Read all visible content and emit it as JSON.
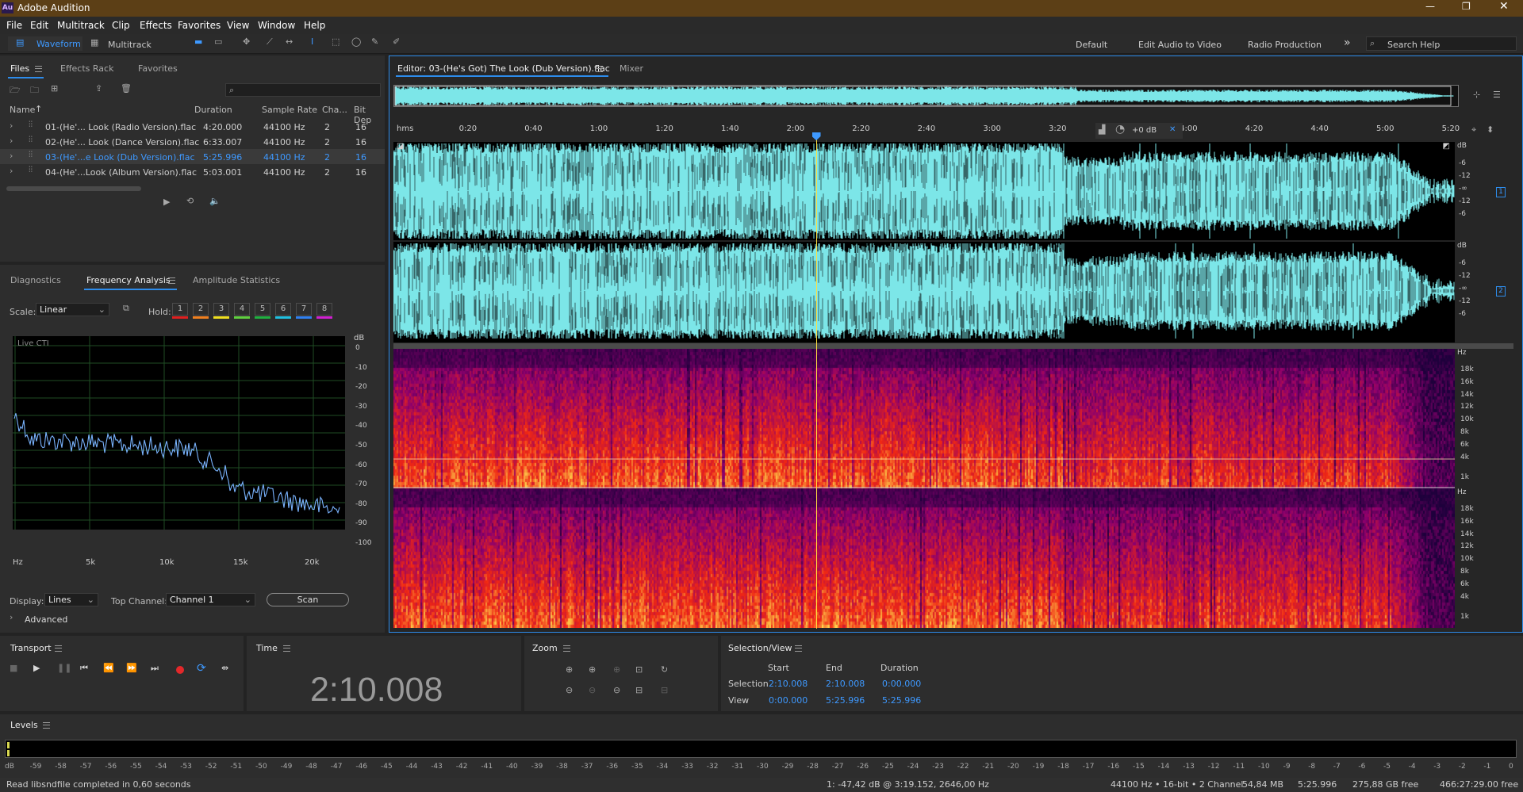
{
  "app": {
    "title": "Adobe Audition",
    "logo": "Au"
  },
  "menu": [
    "File",
    "Edit",
    "Multitrack",
    "Clip",
    "Effects",
    "Favorites",
    "View",
    "Window",
    "Help"
  ],
  "toolbar": {
    "waveform": "Waveform",
    "multitrack": "Multitrack",
    "workspaces": [
      "Default",
      "Edit Audio to Video",
      "Radio Production"
    ],
    "more": "»",
    "search_placeholder": "Search Help"
  },
  "files_panel": {
    "tabs": [
      "Files",
      "Effects Rack",
      "Favorites"
    ],
    "columns": [
      "Name",
      "Duration",
      "Sample Rate",
      "Cha...",
      "Bit Dep"
    ],
    "rows": [
      {
        "name": "01-(He'... Look (Radio Version).flac",
        "duration": "4:20.000",
        "rate": "44100 Hz",
        "ch": "2",
        "bit": "16",
        "selected": false
      },
      {
        "name": "02-(He'... Look (Dance Version).flac",
        "duration": "6:33.007",
        "rate": "44100 Hz",
        "ch": "2",
        "bit": "16",
        "selected": false
      },
      {
        "name": "03-(He'...e Look (Dub Version).flac",
        "duration": "5:25.996",
        "rate": "44100 Hz",
        "ch": "2",
        "bit": "16",
        "selected": true
      },
      {
        "name": "04-(He'...Look (Album Version).flac",
        "duration": "5:03.001",
        "rate": "44100 Hz",
        "ch": "2",
        "bit": "16",
        "selected": false
      }
    ]
  },
  "analysis_panel": {
    "tabs": [
      "Diagnostics",
      "Frequency Analysis",
      "Amplitude Statistics"
    ],
    "scale_label": "Scale:",
    "scale_value": "Linear",
    "hold_label": "Hold:",
    "hold_buttons": [
      "1",
      "2",
      "3",
      "4",
      "5",
      "6",
      "7",
      "8"
    ],
    "hold_colors": [
      "#e02020",
      "#f08020",
      "#f0e020",
      "#60d040",
      "#20b040",
      "#20c0e0",
      "#3080f0",
      "#d020d0"
    ],
    "live_label": "Live CTI",
    "db_unit": "dB",
    "db_ticks": [
      "0",
      "-10",
      "-20",
      "-30",
      "-40",
      "-50",
      "-60",
      "-70",
      "-80",
      "-90",
      "-100"
    ],
    "hz_ticks": [
      "Hz",
      "5k",
      "10k",
      "15k",
      "20k"
    ],
    "display_label": "Display:",
    "display_value": "Lines",
    "top_channel_label": "Top Channel:",
    "top_channel_value": "Channel 1",
    "scan_label": "Scan",
    "advanced_label": "Advanced"
  },
  "editor": {
    "tab_label": "Editor: 03-(He's Got) The Look (Dub Version).flac",
    "mixer_label": "Mixer",
    "ruler": [
      "hms",
      "0:20",
      "0:40",
      "1:00",
      "1:20",
      "1:40",
      "2:00",
      "2:20",
      "2:40",
      "3:00",
      "3:20",
      "3:40",
      "4:00",
      "4:20",
      "4:40",
      "5:00",
      "5:20"
    ],
    "gain_label": "+0 dB",
    "db_scale": [
      "dB",
      "-6",
      "-12",
      "-∞",
      "-12",
      "-6"
    ],
    "hz_scale": [
      "Hz",
      "18k",
      "16k",
      "14k",
      "12k",
      "10k",
      "8k",
      "6k",
      "4k",
      "1k"
    ],
    "channel_badges": [
      "1",
      "2"
    ],
    "playhead_position": 0.398
  },
  "transport": {
    "title": "Transport"
  },
  "time": {
    "title": "Time",
    "value": "2:10.008"
  },
  "zoom": {
    "title": "Zoom"
  },
  "selection_view": {
    "title": "Selection/View",
    "headers": [
      "Start",
      "End",
      "Duration"
    ],
    "rows": [
      {
        "label": "Selection",
        "start": "2:10.008",
        "end": "2:10.008",
        "duration": "0:00.000"
      },
      {
        "label": "View",
        "start": "0:00.000",
        "end": "5:25.996",
        "duration": "5:25.996"
      }
    ]
  },
  "levels": {
    "title": "Levels",
    "ticks": [
      "dB",
      "-59",
      "-58",
      "-57",
      "-56",
      "-55",
      "-54",
      "-53",
      "-52",
      "-51",
      "-50",
      "-49",
      "-48",
      "-47",
      "-46",
      "-45",
      "-44",
      "-43",
      "-42",
      "-41",
      "-40",
      "-39",
      "-38",
      "-37",
      "-36",
      "-35",
      "-34",
      "-33",
      "-32",
      "-31",
      "-30",
      "-29",
      "-28",
      "-27",
      "-26",
      "-25",
      "-24",
      "-23",
      "-22",
      "-21",
      "-20",
      "-19",
      "-18",
      "-17",
      "-16",
      "-15",
      "-14",
      "-13",
      "-12",
      "-11",
      "-10",
      "-9",
      "-8",
      "-7",
      "-6",
      "-5",
      "-4",
      "-3",
      "-2",
      "-1",
      "0"
    ]
  },
  "status": {
    "message": "Read libsndfile completed in 0,60 seconds",
    "cursor": "1: -47,42 dB @ 3:19.152, 2646,00 Hz",
    "format": "44100 Hz • 16-bit • 2 Channel",
    "size": "54,84 MB",
    "duration": "5:25.996",
    "free": "275,88 GB free",
    "free_time": "466:27:29.00 free"
  },
  "colors": {
    "accent": "#2d8ceb",
    "waveform": "#7ce6e8",
    "titlebar": "#5c3f16"
  }
}
